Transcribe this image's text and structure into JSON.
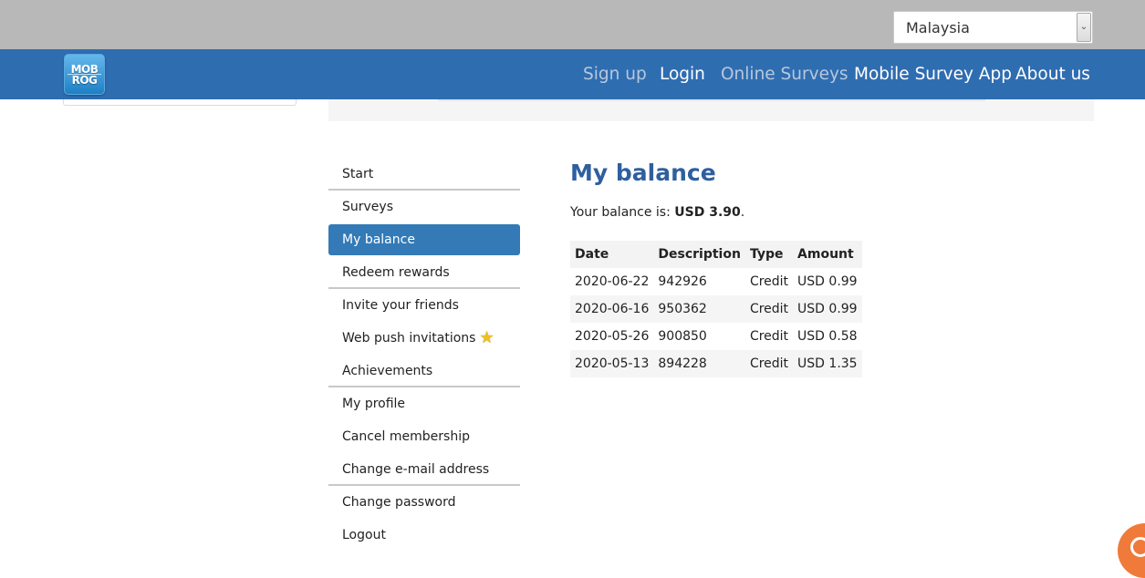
{
  "header": {
    "country_select": {
      "value": "Malaysia"
    },
    "logo": {
      "line1": "MOB",
      "line2": "ROG"
    },
    "nav": [
      {
        "label": "Sign up"
      },
      {
        "label": "Login"
      },
      {
        "label": "Online Surveys"
      },
      {
        "label": "Mobile Survey App"
      },
      {
        "label": "About us"
      }
    ]
  },
  "sidebar": {
    "items": [
      {
        "label": "Start"
      },
      {
        "label": "Surveys"
      },
      {
        "label": "My balance"
      },
      {
        "label": "Redeem rewards"
      },
      {
        "label": "Invite your friends"
      },
      {
        "label": "Web push invitations"
      },
      {
        "label": "Achievements"
      },
      {
        "label": "My profile"
      },
      {
        "label": "Cancel membership"
      },
      {
        "label": "Change e-mail address"
      },
      {
        "label": "Change password"
      },
      {
        "label": "Logout"
      }
    ],
    "active_item": "My balance"
  },
  "main": {
    "title": "My balance",
    "balance_prefix": "Your balance is: ",
    "balance_value": "USD 3.90",
    "balance_suffix": ".",
    "table": {
      "columns": [
        "Date",
        "Description",
        "Type",
        "Amount"
      ],
      "rows": [
        [
          "2020-06-22",
          "942926",
          "Credit",
          "USD 0.99"
        ],
        [
          "2020-06-16",
          "950362",
          "Credit",
          "USD 0.99"
        ],
        [
          "2020-05-26",
          "900850",
          "Credit",
          "USD 0.58"
        ],
        [
          "2020-05-13",
          "894228",
          "Credit",
          "USD 1.35"
        ]
      ]
    }
  },
  "icons": {
    "select_arrow": "chevron-down-icon",
    "web_push_badge": "star-icon",
    "chat_widget": "chat-icon"
  },
  "colors": {
    "navbar": "#2f6db1",
    "topbar": "#b8b8b8",
    "active_menu": "#337ab7",
    "title": "#2f5f9e",
    "chat_widget": "#f07a3a"
  }
}
